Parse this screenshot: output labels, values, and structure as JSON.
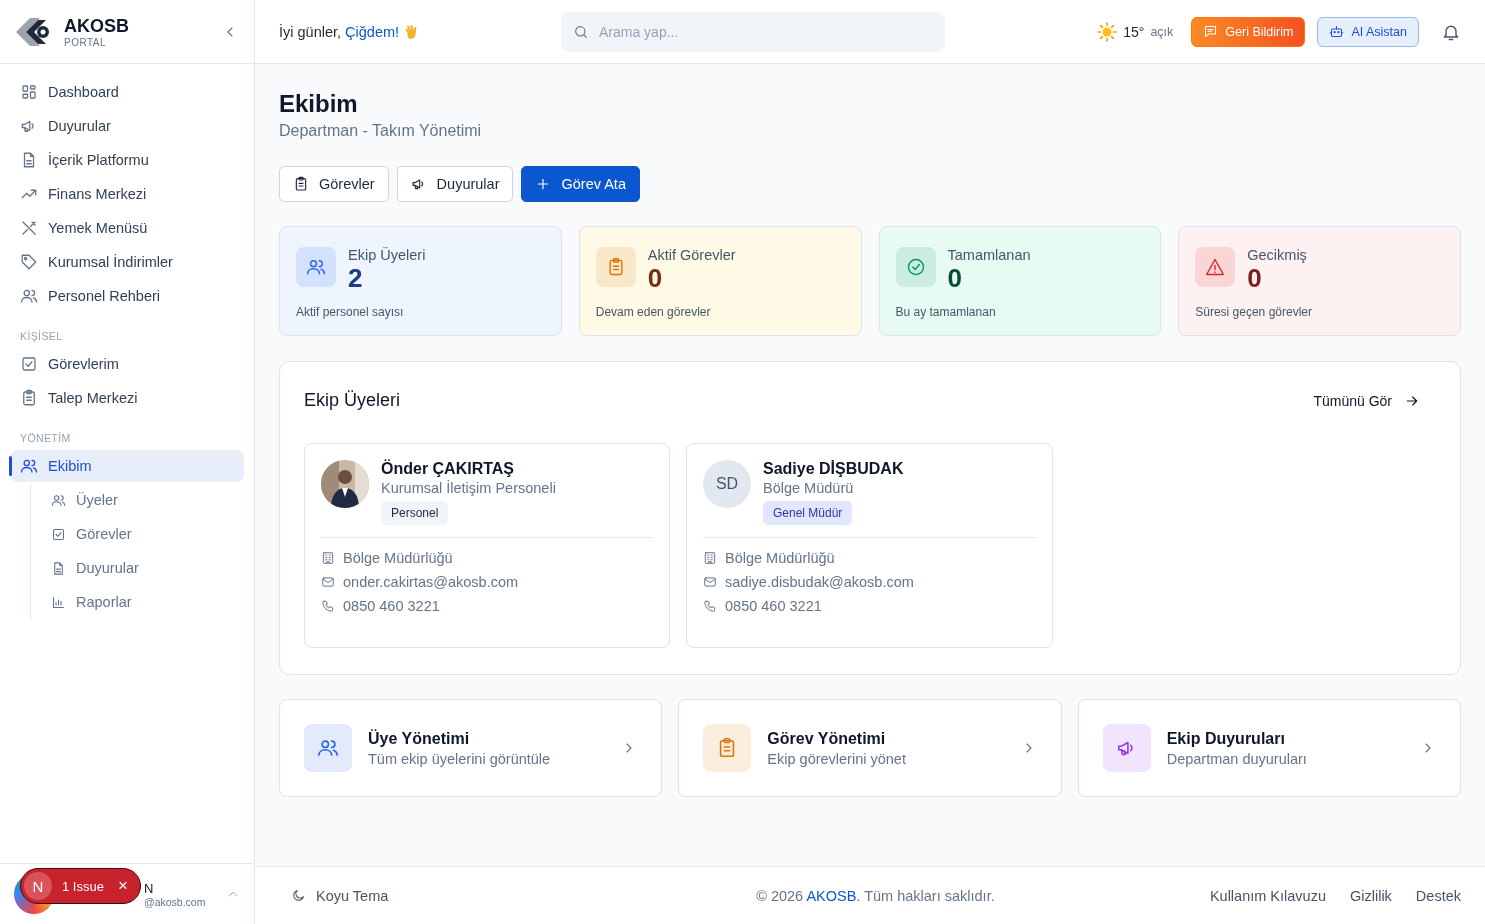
{
  "sidebar": {
    "logo": {
      "name": "AKOSB",
      "subtitle": "PORTAL"
    },
    "items": [
      {
        "label": "Dashboard",
        "selected": false
      },
      {
        "label": "Duyurular",
        "selected": false
      },
      {
        "label": "İçerik Platformu",
        "selected": false
      },
      {
        "label": "Finans Merkezi",
        "selected": false
      },
      {
        "label": "Yemek Menüsü",
        "selected": false
      },
      {
        "label": "Kurumsal İndirimler",
        "selected": false
      },
      {
        "label": "Personel Rehberi",
        "selected": false
      }
    ],
    "sections": [
      {
        "title": "KİŞİSEL",
        "items": [
          {
            "label": "Görevlerim",
            "selected": false
          },
          {
            "label": "Talep Merkezi",
            "selected": false
          }
        ]
      },
      {
        "title": "YÖNETİM",
        "items": [
          {
            "label": "Ekibim",
            "selected": true,
            "expanded": true,
            "children": [
              {
                "label": "Üyeler",
                "selected": false
              },
              {
                "label": "Görevler",
                "selected": false
              },
              {
                "label": "Duyurular",
                "selected": false
              },
              {
                "label": "Raporlar",
                "selected": false
              }
            ]
          }
        ]
      }
    ],
    "user": {
      "name": "N",
      "email": "@akosb.com"
    }
  },
  "dev_overlay": {
    "letter": "N",
    "label": "1 Issue",
    "close": "×"
  },
  "topbar": {
    "greeting": "İyi günler, ",
    "user_name": "Çiğdem!",
    "search": {
      "placeholder": "Arama yap..."
    },
    "weather": {
      "temperature": "15°",
      "condition": "açık"
    },
    "buttons": [
      {
        "label": "Geri Bildirim",
        "kind": "feedback"
      },
      {
        "label": "AI Asistan",
        "kind": "assistant"
      }
    ]
  },
  "page": {
    "title": "Ekibim",
    "subtitle": "Departman - Takım Yönetimi",
    "actions": [
      {
        "label": "Görevler",
        "kind": "outline"
      },
      {
        "label": "Duyurular",
        "kind": "outline"
      },
      {
        "label": "Görev Ata",
        "kind": "primary"
      }
    ]
  },
  "stats": [
    {
      "title": "Ekip Üyeleri",
      "value": "2",
      "caption": "Aktif personel sayısı",
      "color": "#2563eb"
    },
    {
      "title": "Aktif Görevler",
      "value": "0",
      "caption": "Devam eden görevler",
      "color": "#d97706"
    },
    {
      "title": "Tamamlanan",
      "value": "0",
      "caption": "Bu ay tamamlanan",
      "color": "#059669"
    },
    {
      "title": "Gecikmiş",
      "value": "0",
      "caption": "Süresi geçen görevler",
      "color": "#dc2626"
    }
  ],
  "team": {
    "title": "Ekip Üyeleri",
    "link": "Tümünü Gör",
    "members": [
      {
        "name": "Önder ÇAKIRTAŞ",
        "role": "Kurumsal İletişim Personeli",
        "badge": {
          "label": "Personel",
          "color": "#f1f5f9"
        },
        "department": "Bölge Müdürlüğü",
        "email": "onder.cakirtas@akosb.com",
        "phone": "0850 460 3221"
      },
      {
        "kind": "initials",
        "initials": "SD",
        "name": "Sadiye DİŞBUDAK",
        "role": "Bölge Müdürü",
        "badge": {
          "label": "Genel Müdür",
          "color": "#e0e7ff"
        },
        "department": "Bölge Müdürlüğü",
        "email": "sadiye.disbudak@akosb.com",
        "phone": "0850 460 3221"
      }
    ]
  },
  "shortcuts": [
    {
      "title": "Üye Yönetimi",
      "subtitle": "Tüm ekip üyelerini görüntüle",
      "color": "#2563eb"
    },
    {
      "title": "Görev Yönetimi",
      "subtitle": "Ekip görevlerini yönet",
      "color": "#d97706"
    },
    {
      "title": "Ekip Duyuruları",
      "subtitle": "Departman duyuruları",
      "color": "#9333ea"
    }
  ],
  "footer": {
    "theme": "Koyu Tema",
    "copyright_before": "© 2026 ",
    "copyright_link": "AKOSB",
    "copyright_after": ". Tüm hakları saklıdır.",
    "links": [
      "Kullanım Kılavuzu",
      "Gizlilik",
      "Destek"
    ]
  }
}
